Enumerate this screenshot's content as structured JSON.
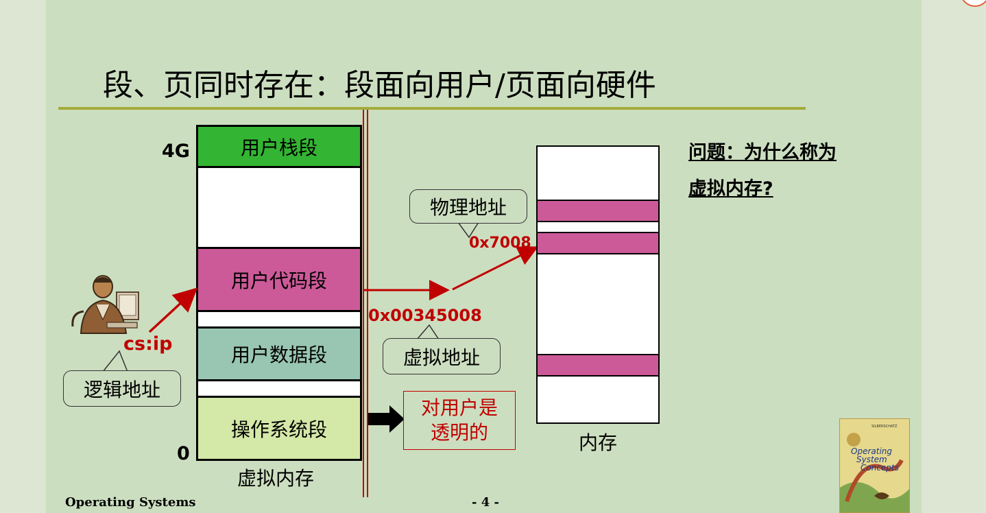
{
  "title": "段、页同时存在：段面向用户/页面向硬件",
  "virtual_memory": {
    "label": "虚拟内存",
    "top_tick": "4G",
    "bottom_tick": "0",
    "segments": [
      {
        "label": "用户栈段",
        "color": "#33b533"
      },
      {
        "label": "",
        "color": "#ffffff"
      },
      {
        "label": "用户代码段",
        "color": "#cc5a99"
      },
      {
        "label": "",
        "color": "#ffffff"
      },
      {
        "label": "用户数据段",
        "color": "#99c6b3"
      },
      {
        "label": "",
        "color": "#ffffff"
      },
      {
        "label": "操作系统段",
        "color": "#d4e8a8"
      }
    ]
  },
  "logical": {
    "register": "cs:ip",
    "callout": "逻辑地址"
  },
  "virtual_address": {
    "value": "0x00345008",
    "callout": "虚拟地址"
  },
  "physical_address": {
    "value": "0x7008",
    "callout": "物理地址"
  },
  "transparent_note": {
    "line1": "对用户是",
    "line2": "透明的"
  },
  "physical_memory": {
    "label": "内存"
  },
  "question": {
    "line1": "问题：为什么称为",
    "line2": "虚拟内存?"
  },
  "footer": {
    "course": "Operating Systems",
    "page": "- 4 -"
  },
  "book_cover": {
    "title_line1": "Operating",
    "title_line2": "System",
    "title_line3": "Concepts",
    "authors": "SILBERSCHATZ"
  },
  "colors": {
    "accent_red": "#c00000",
    "title_rule": "#a3ab3a",
    "background": "#ccdec0"
  }
}
